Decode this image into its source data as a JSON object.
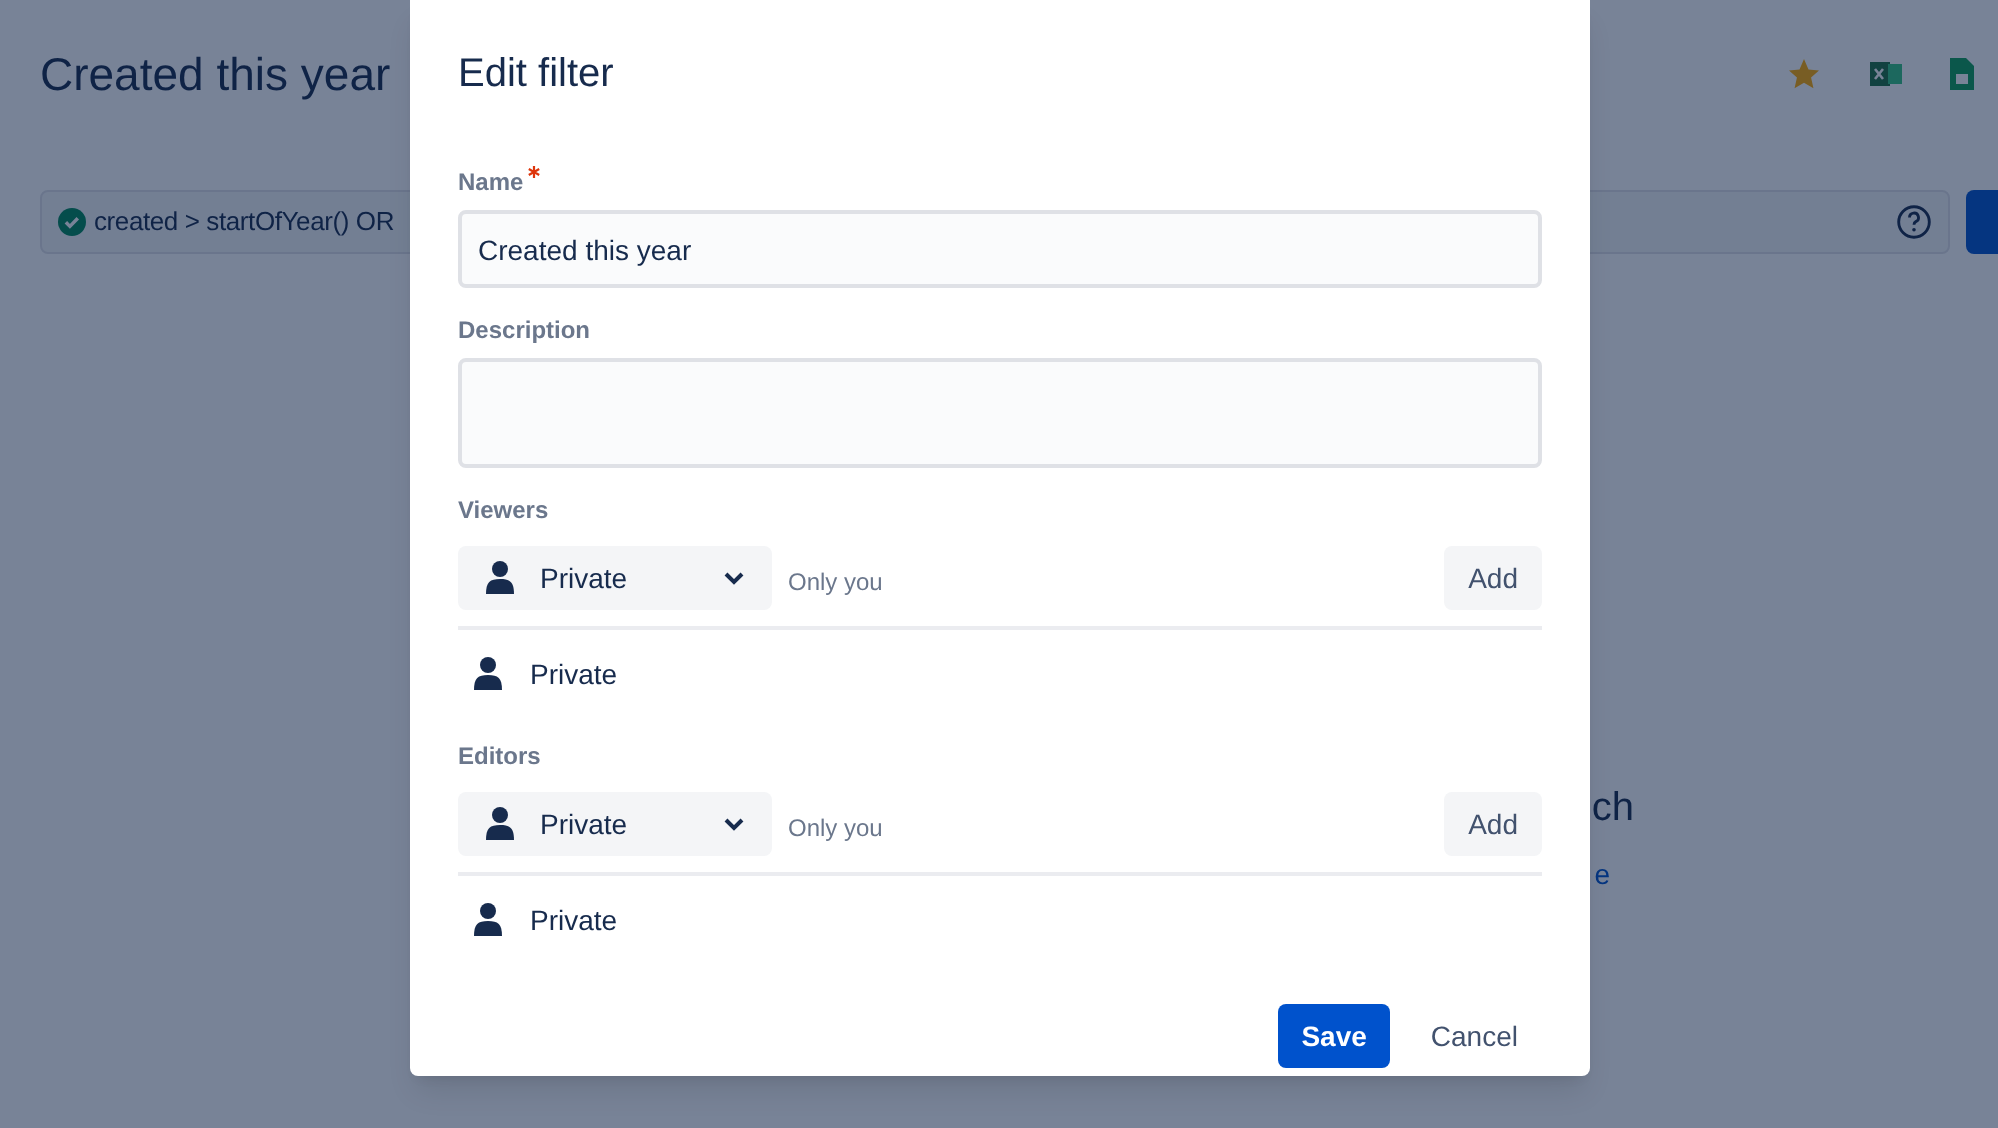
{
  "page": {
    "title": "Created this year",
    "query": "created > startOfYear() OR",
    "heading_fragment": "ch",
    "link_fragment": "e"
  },
  "dialog": {
    "title": "Edit filter",
    "fields": [
      {
        "kind": "input",
        "label": "Name",
        "required": true,
        "value": "Created this year"
      },
      {
        "kind": "textarea",
        "label": "Description",
        "required": false
      }
    ],
    "sharing": [
      {
        "label": "Viewers",
        "select": "Private",
        "hint": "Only you",
        "button": "Add",
        "entry": "Private"
      },
      {
        "label": "Editors",
        "select": "Private",
        "hint": "Only you",
        "button": "Add",
        "entry": "Private"
      }
    ],
    "buttons": [
      {
        "kind": "primary",
        "label": "Save"
      },
      {
        "kind": "subtle",
        "label": "Cancel"
      }
    ]
  }
}
